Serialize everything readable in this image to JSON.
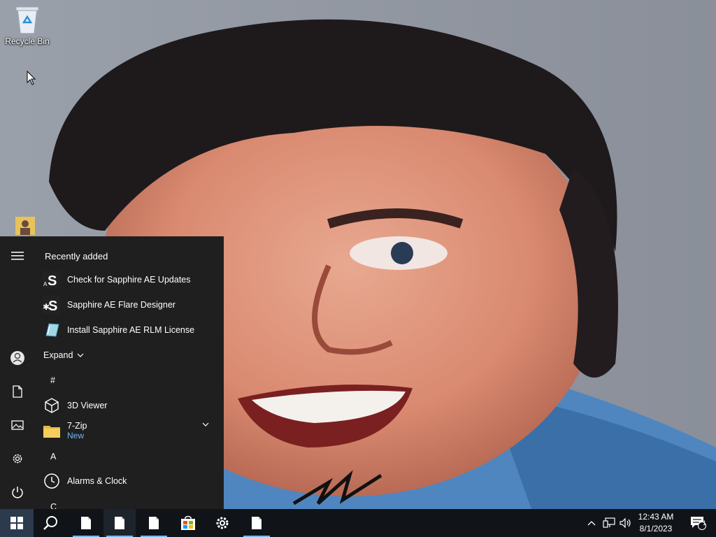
{
  "desktop": {
    "recycle_bin_label": "Recycle Bin"
  },
  "start_menu": {
    "recently_added_title": "Recently added",
    "recent_apps": [
      {
        "name": "Check for Sapphire AE Updates",
        "icon": "sapphire-s-icon"
      },
      {
        "name": "Sapphire AE Flare Designer",
        "icon": "sapphire-flare-icon"
      },
      {
        "name": "Install Sapphire AE RLM License",
        "icon": "license-installer-icon"
      }
    ],
    "expand_label": "Expand",
    "groups": [
      {
        "letter": "#"
      },
      {
        "letter": "A"
      },
      {
        "letter": "C"
      }
    ],
    "apps": [
      {
        "name": "3D Viewer",
        "icon": "cube-icon"
      },
      {
        "name": "7-Zip",
        "sub": "New",
        "icon": "folder-icon"
      },
      {
        "name": "Alarms & Clock",
        "icon": "clock-icon"
      }
    ]
  },
  "taskbar": {
    "clock_time": "12:43 AM",
    "clock_date": "8/1/2023",
    "notification_count": "1"
  },
  "colors": {
    "start_menu_bg": "#1f1f1f",
    "taskbar_bg": "#101418",
    "accent": "#76b9ed",
    "new_badge": "#6fb4ff"
  }
}
